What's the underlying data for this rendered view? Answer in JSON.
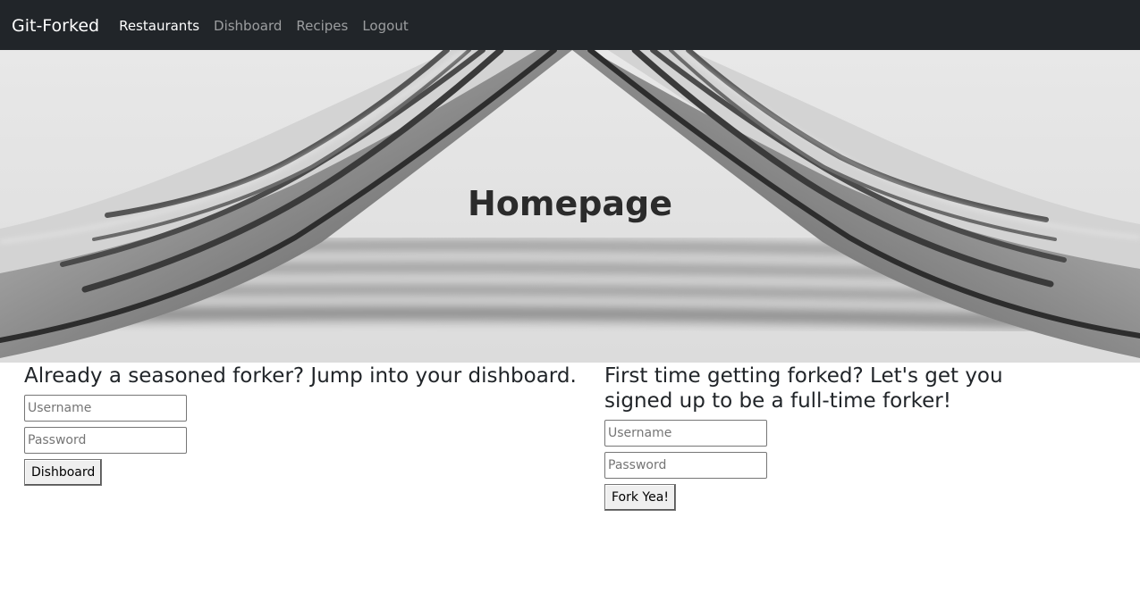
{
  "navbar": {
    "brand": "Git-Forked",
    "links": [
      {
        "label": "Restaurants",
        "active": true
      },
      {
        "label": "Dishboard",
        "active": false
      },
      {
        "label": "Recipes",
        "active": false
      },
      {
        "label": "Logout",
        "active": false
      }
    ]
  },
  "hero": {
    "title": "Homepage"
  },
  "login": {
    "heading": "Already a seasoned forker? Jump into your dishboard.",
    "username_placeholder": "Username",
    "password_placeholder": "Password",
    "submit_label": "Dishboard"
  },
  "signup": {
    "heading": "First time getting forked? Let's get you signed up to be a full-time forker!",
    "username_placeholder": "Username",
    "password_placeholder": "Password",
    "submit_label": "Fork Yea!"
  },
  "colors": {
    "navbar_bg": "#212529",
    "nav_active": "#ffffff",
    "nav_inactive": "#9a9da0"
  }
}
